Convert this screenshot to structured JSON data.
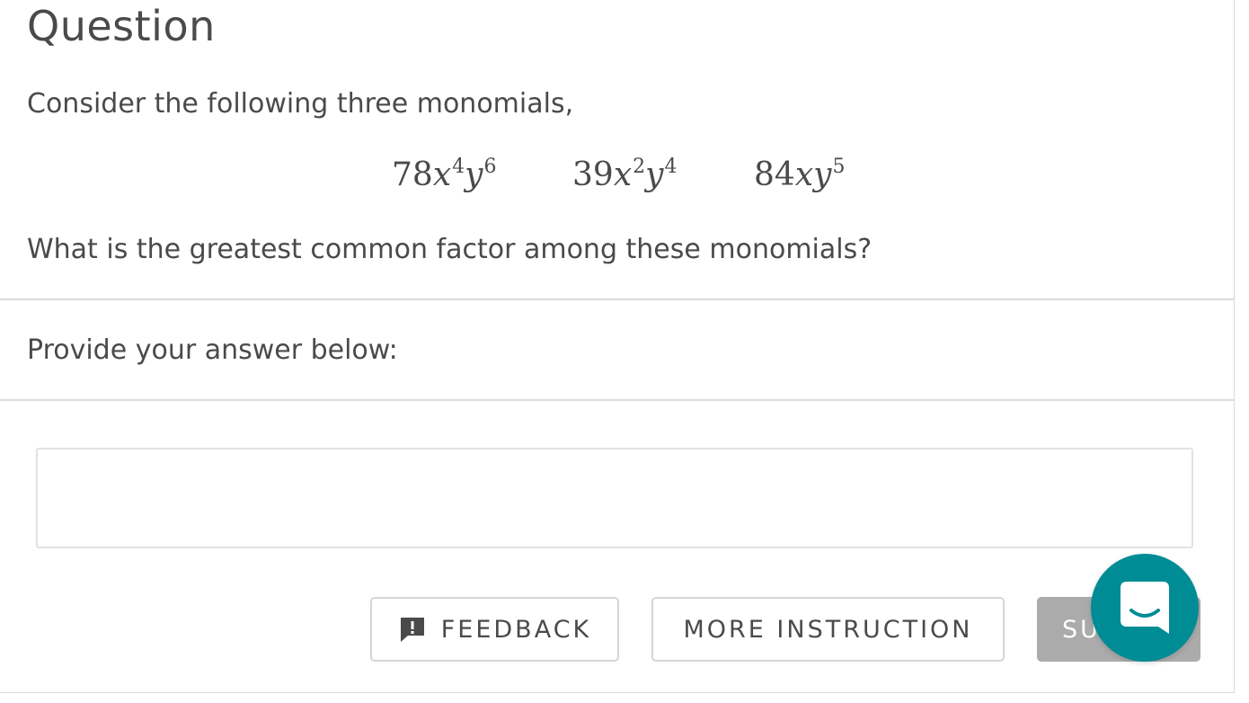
{
  "question": {
    "title": "Question",
    "intro": "Consider the following three monomials,",
    "monomials": [
      {
        "coef": "78",
        "vars": [
          {
            "v": "x",
            "e": "4"
          },
          {
            "v": "y",
            "e": "6"
          }
        ]
      },
      {
        "coef": "39",
        "vars": [
          {
            "v": "x",
            "e": "2"
          },
          {
            "v": "y",
            "e": "4"
          }
        ]
      },
      {
        "coef": "84",
        "vars": [
          {
            "v": "x",
            "e": ""
          },
          {
            "v": "y",
            "e": "5"
          }
        ]
      }
    ],
    "prompt": "What is the greatest common factor among these monomials?"
  },
  "answer": {
    "label": "Provide your answer below:",
    "value": "",
    "placeholder": ""
  },
  "actions": {
    "feedback_label": "FEEDBACK",
    "more_instruction_label": "MORE INSTRUCTION",
    "submit_label_visible": "SU"
  },
  "icons": {
    "feedback": "feedback-exclamation-icon",
    "chat": "chat-smile-icon"
  },
  "colors": {
    "text": "#4a4a4a",
    "chat_launcher": "#008c95",
    "submit_disabled": "#ababab",
    "border": "#d6d6d6"
  }
}
